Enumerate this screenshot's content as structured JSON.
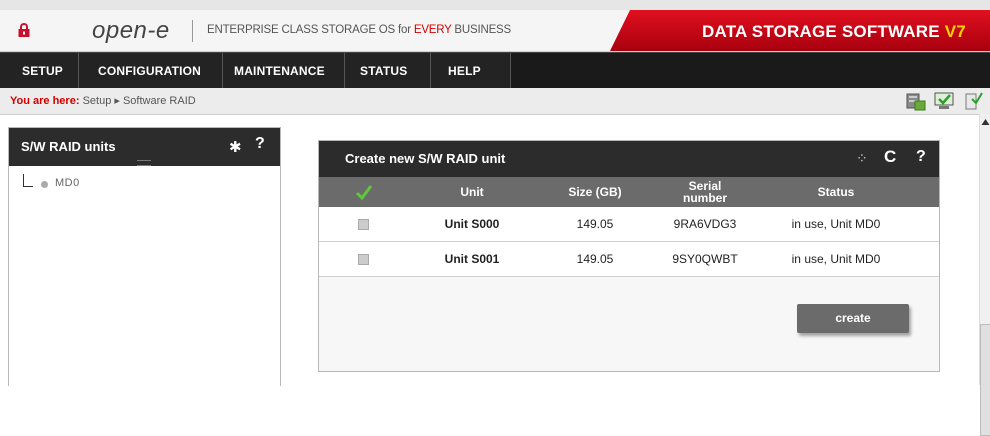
{
  "header": {
    "logo_text": "open-e",
    "tagline_prefix": "ENTERPRISE CLASS STORAGE OS for ",
    "tagline_highlight": "EVERY",
    "tagline_suffix": " BUSINESS",
    "banner_text": "DATA STORAGE SOFTWARE ",
    "banner_version": "V7",
    "colors": {
      "accent_red": "#c8102e",
      "banner_red": "#c40010",
      "version_yellow": "#ffd200"
    }
  },
  "nav": {
    "items": [
      {
        "label": "SETUP"
      },
      {
        "label": "CONFIGURATION"
      },
      {
        "label": "MAINTENANCE"
      },
      {
        "label": "STATUS"
      },
      {
        "label": "HELP"
      }
    ]
  },
  "breadcrumb": {
    "prefix": "You are here:",
    "path": "Setup ▸ Software RAID",
    "icons": [
      "server-icon",
      "monitor-check-icon",
      "info-icon"
    ]
  },
  "left_panel": {
    "title": "S/W RAID units",
    "icons": [
      "gear-icon",
      "help-icon"
    ],
    "tree": [
      {
        "label": "MD0"
      }
    ]
  },
  "main_panel": {
    "title": "Create new S/W RAID unit",
    "icons": [
      "spinner-icon",
      "refresh-icon",
      "help-icon"
    ],
    "columns": [
      "Unit",
      "Size (GB)",
      "Serial number",
      "Status"
    ],
    "column_serial_line1": "Serial",
    "column_serial_line2": "number",
    "rows": [
      {
        "unit": "Unit S000",
        "size": "149.05",
        "serial": "9RA6VDG3",
        "status": "in use, Unit MD0",
        "checked": false
      },
      {
        "unit": "Unit S001",
        "size": "149.05",
        "serial": "9SY0QWBT",
        "status": "in use, Unit MD0",
        "checked": false
      }
    ],
    "create_label": "create"
  }
}
